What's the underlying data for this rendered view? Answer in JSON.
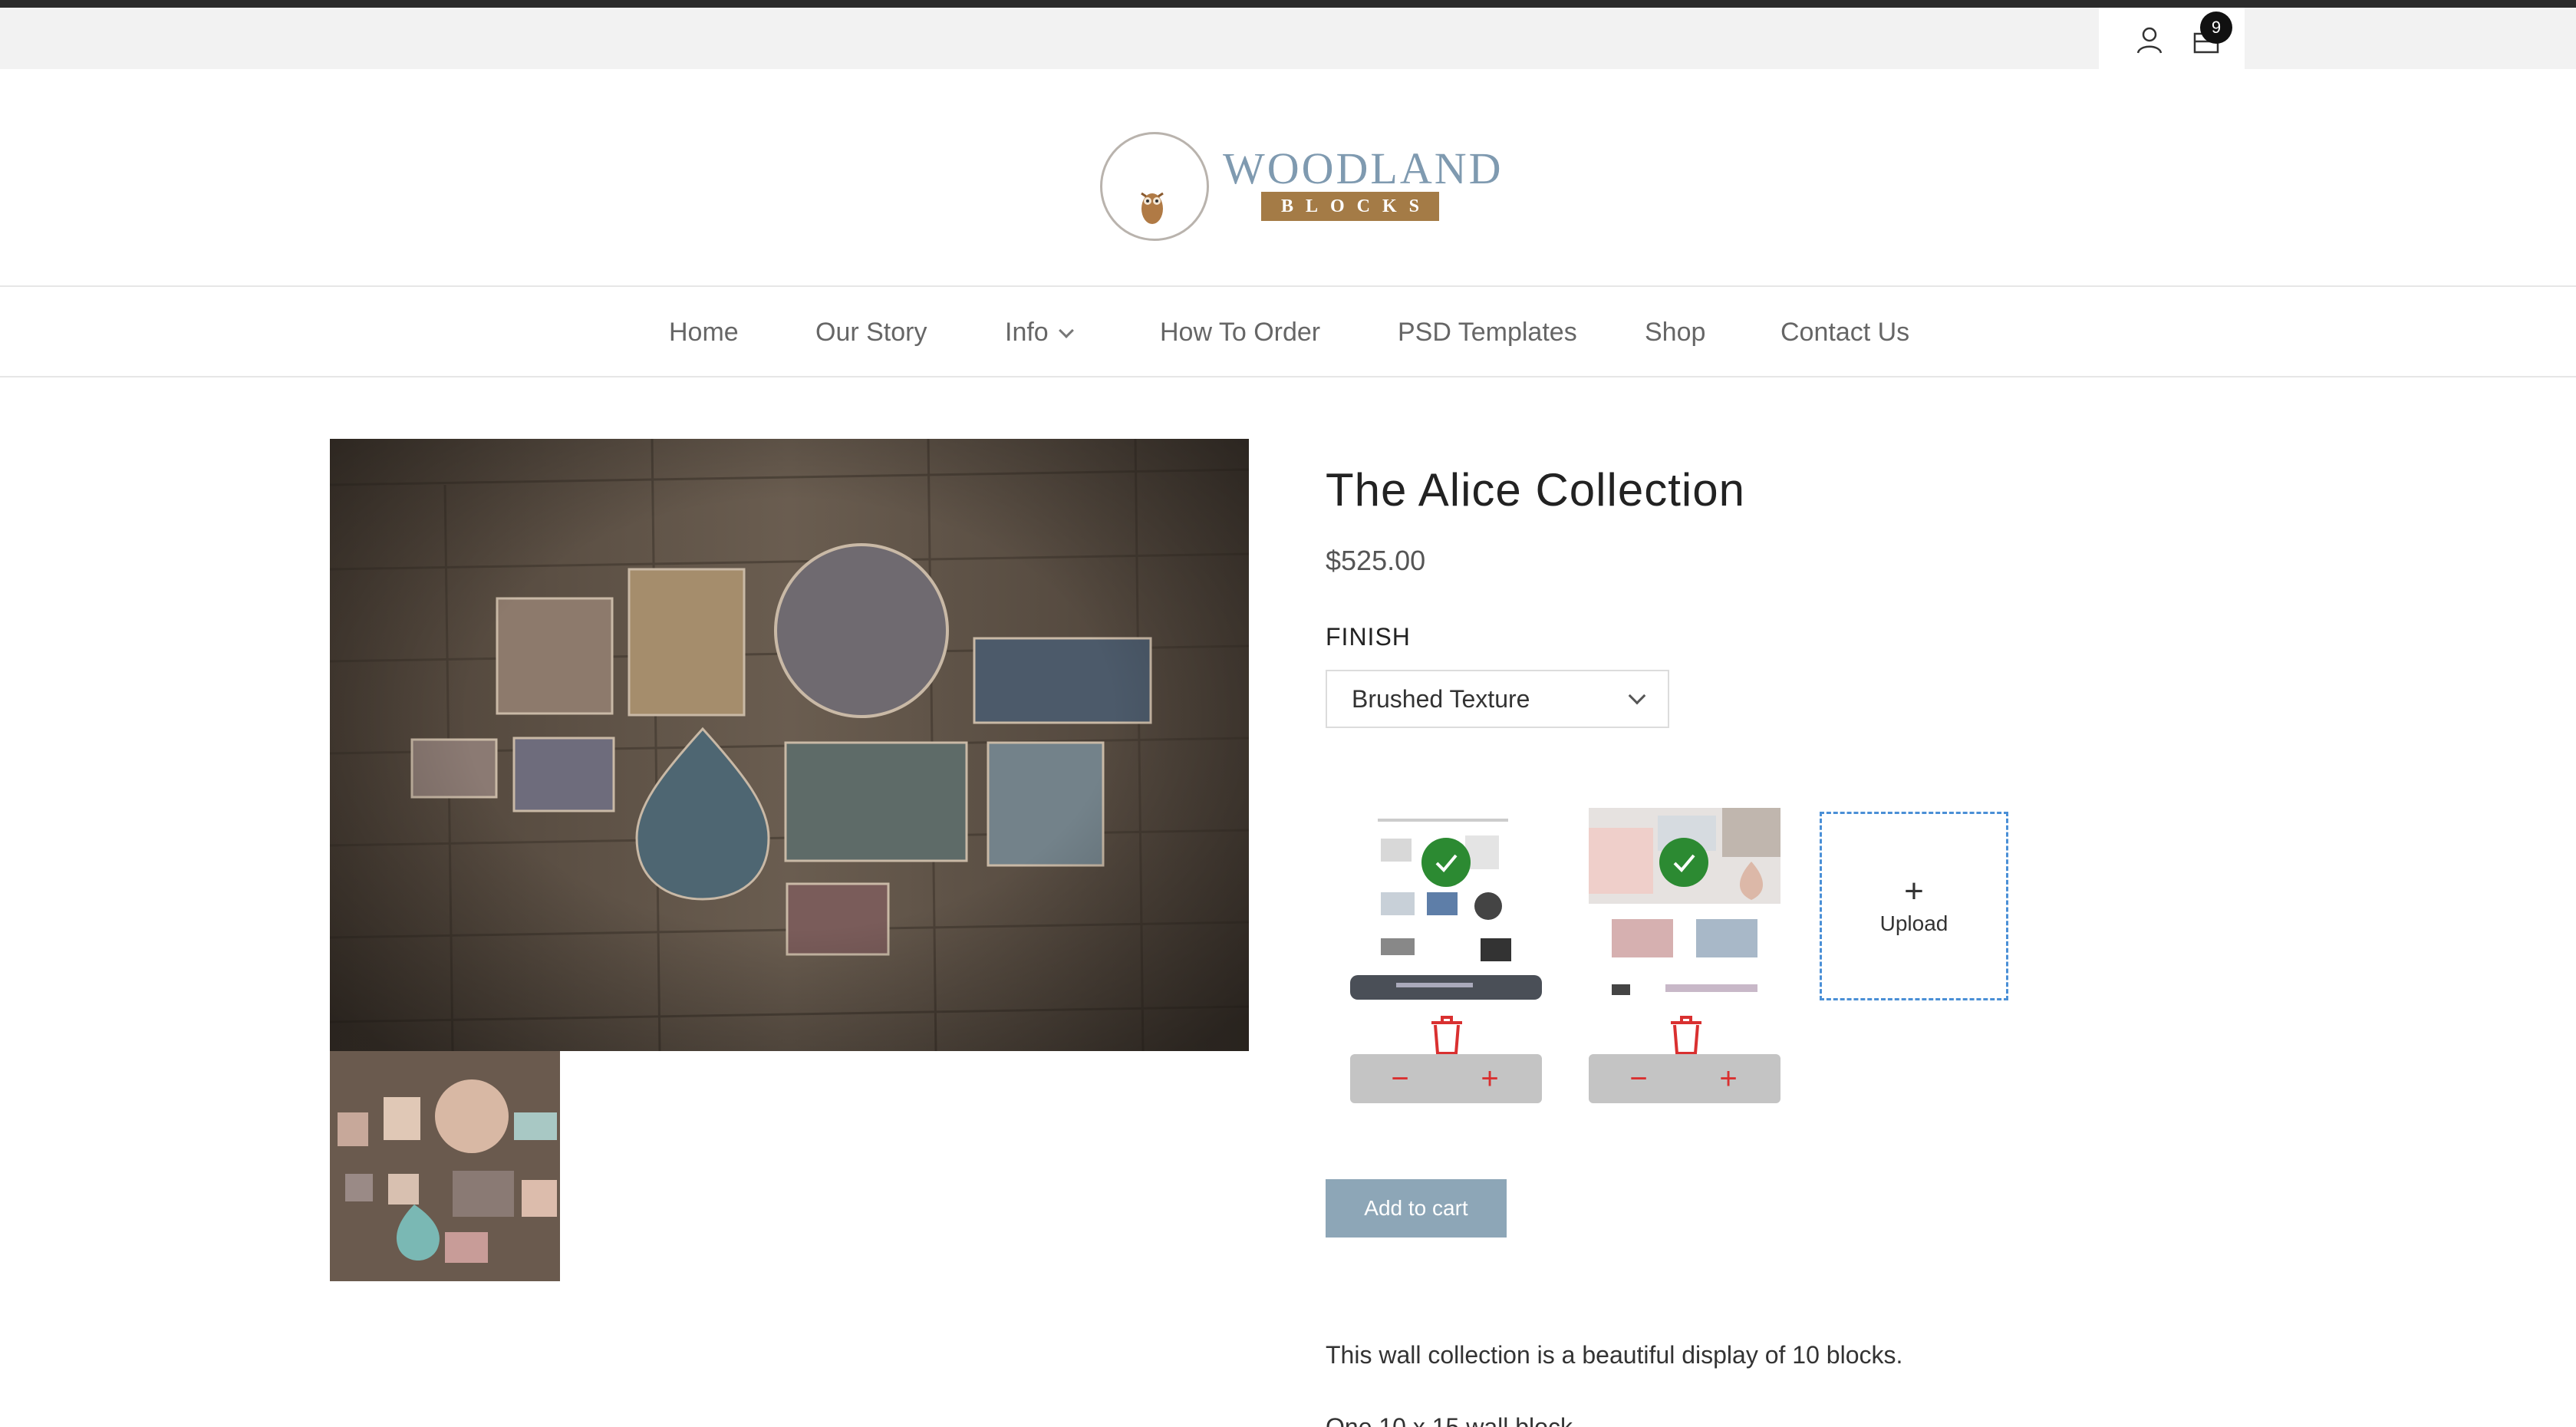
{
  "header": {
    "cart_count": "9",
    "logo": {
      "word": "WOODLAND",
      "sub": "BLOCKS"
    }
  },
  "nav": {
    "items": [
      {
        "label": "Home"
      },
      {
        "label": "Our Story"
      },
      {
        "label": "Info"
      },
      {
        "label": "How To Order"
      },
      {
        "label": "PSD Templates"
      },
      {
        "label": "Shop"
      },
      {
        "label": "Contact Us"
      }
    ]
  },
  "product": {
    "title": "The Alice Collection",
    "price": "$525.00",
    "finish_label": "FINISH",
    "finish_value": "Brushed Texture",
    "upload_label": "Upload",
    "add_to_cart": "Add to cart",
    "description": "This wall collection is a beautiful display of 10 blocks.",
    "description_partial": "One 10 x 15 wall block"
  },
  "colors": {
    "accent_blue": "#8da6b7",
    "check_green": "#2c8a32",
    "trash_red": "#d93030",
    "logo_brown": "#a47b46",
    "logo_blue": "#7f9ab0"
  }
}
